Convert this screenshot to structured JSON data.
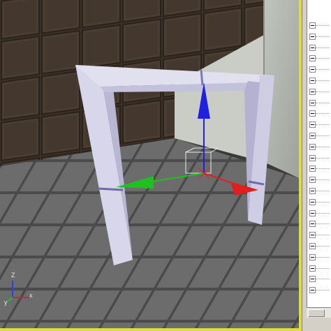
{
  "viewport": {
    "name": "perspective-viewport",
    "accent_border": "#e0dc40"
  },
  "gizmo": {
    "axes": [
      "x",
      "y",
      "z"
    ],
    "colors": {
      "x": "#e02020",
      "y": "#20c020",
      "z": "#2020e0"
    }
  },
  "tripod": {
    "z_label": "Z",
    "x_label": "x",
    "y_label": "y",
    "colors": {
      "x": "#e02020",
      "y": "#20c020",
      "z": "#2040ff"
    }
  },
  "side_panel": {
    "rows": 25
  }
}
